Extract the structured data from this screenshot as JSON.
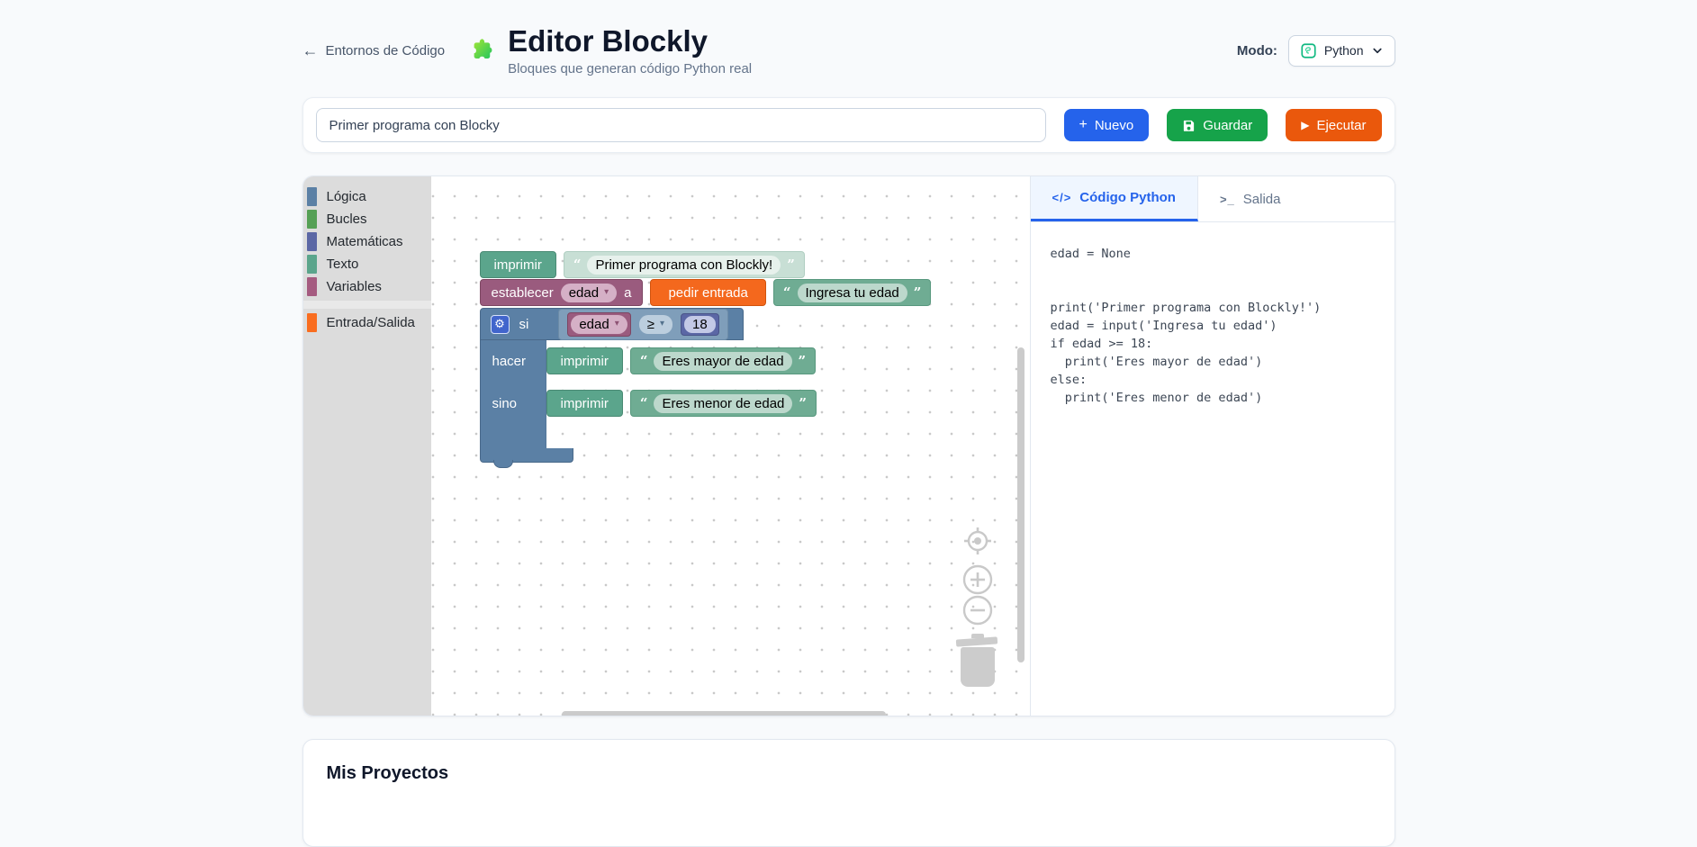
{
  "header": {
    "back_label": "Entornos de Código",
    "title": "Editor Blockly",
    "subtitle": "Bloques que generan código Python real",
    "mode_label": "Modo:",
    "mode_value": "Python"
  },
  "toolbar": {
    "project_name": "Primer programa con Blocky",
    "new_label": "Nuevo",
    "save_label": "Guardar",
    "run_label": "Ejecutar"
  },
  "toolbox": {
    "categories": [
      {
        "label": "Lógica",
        "color": "#5b80a5"
      },
      {
        "label": "Bucles",
        "color": "#55a055"
      },
      {
        "label": "Matemáticas",
        "color": "#5b67a5"
      },
      {
        "label": "Texto",
        "color": "#5ba58c"
      },
      {
        "label": "Variables",
        "color": "#a55b80"
      },
      {
        "label": "Entrada/Salida",
        "color": "#f96d1f"
      }
    ]
  },
  "blocks": {
    "print1": {
      "label": "imprimir",
      "value": "Primer programa con Blockly!"
    },
    "set_var": {
      "label": "establecer",
      "var": "edad",
      "connector": "a"
    },
    "input_block": {
      "label": "pedir entrada",
      "prompt": "Ingresa tu edad"
    },
    "if_block": {
      "if_label": "si",
      "var": "edad",
      "op": "≥",
      "value": "18",
      "do_label": "hacer",
      "else_label": "sino"
    },
    "print_true": {
      "label": "imprimir",
      "value": "Eres mayor de edad"
    },
    "print_false": {
      "label": "imprimir",
      "value": "Eres menor de edad"
    }
  },
  "code_panel": {
    "tab_code": "Código Python",
    "tab_output": "Salida",
    "code": "edad = None\n\n\nprint('Primer programa con Blockly!')\nedad = input('Ingresa tu edad')\nif edad >= 18:\n  print('Eres mayor de edad')\nelse:\n  print('Eres menor de edad')"
  },
  "projects": {
    "title": "Mis Proyectos"
  },
  "icons": {
    "back_arrow": "←",
    "plus": "+",
    "play": "▶",
    "gear": "⚙",
    "open_quote": "“",
    "close_quote": "”",
    "dropdown_arrow": "▾",
    "code_tab": "</>",
    "terminal_tab": ">_"
  },
  "colors": {
    "accent_blue": "#2563eb",
    "save_green": "#16a34a",
    "run_orange": "#ea580c",
    "logic_blue": "#5b80a5",
    "text_green": "#5ba58c",
    "variable_magenta": "#a55b80",
    "io_orange": "#f4681d",
    "math_indigo": "#5b67a5"
  }
}
